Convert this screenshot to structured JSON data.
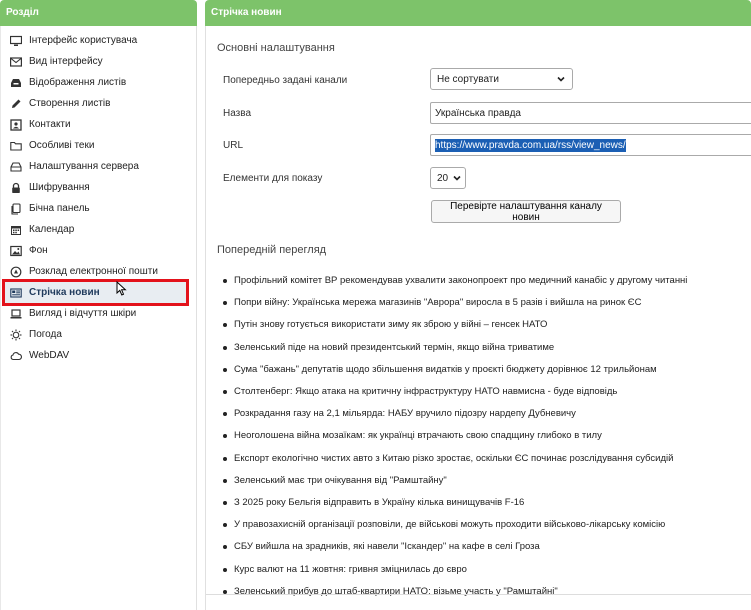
{
  "left": {
    "header": "Розділ",
    "items": [
      {
        "label": "Інтерфейс користувача",
        "icon": "monitor-icon"
      },
      {
        "label": "Вид інтерфейсу",
        "icon": "envelope-icon"
      },
      {
        "label": "Відображення листів",
        "icon": "inbox-icon"
      },
      {
        "label": "Створення листів",
        "icon": "pencil-icon"
      },
      {
        "label": "Контакти",
        "icon": "contact-card-icon"
      },
      {
        "label": "Особливі теки",
        "icon": "folder-icon"
      },
      {
        "label": "Налаштування сервера",
        "icon": "server-icon"
      },
      {
        "label": "Шифрування",
        "icon": "lock-icon"
      },
      {
        "label": "Бічна панель",
        "icon": "copy-icon"
      },
      {
        "label": "Календар",
        "icon": "calendar-icon"
      },
      {
        "label": "Фон",
        "icon": "image-icon"
      },
      {
        "label": "Розклад електронної пошти",
        "icon": "clock-send-icon"
      },
      {
        "label": "Стрічка новин",
        "icon": "newspaper-icon"
      },
      {
        "label": "Вигляд і відчуття шкіри",
        "icon": "laptop-icon"
      },
      {
        "label": "Погода",
        "icon": "sun-icon"
      },
      {
        "label": "WebDAV",
        "icon": "cloud-icon"
      }
    ]
  },
  "right": {
    "header": "Стрічка новин",
    "basic_title": "Основні налаштування",
    "preset_label": "Попередньо задані канали",
    "preset_value": "Не сортувати",
    "name_label": "Назва",
    "name_value": "Українська правда",
    "url_label": "URL",
    "url_value": "https://www.pravda.com.ua/rss/view_news/",
    "items_label": "Елементи для показу",
    "items_value": "20",
    "check_button": "Перевірте налаштування каналу новин",
    "preview_title": "Попередній перегляд",
    "news": [
      "Профільний комітет ВР рекомендував ухвалити законопроект про медичний канабіс у другому читанні",
      "Попри війну: Українська мережа магазинів \"Аврора\" виросла в 5 разів і вийшла на ринок ЄС",
      "Путін знову готується використати зиму як зброю у війні – генсек НАТО",
      "Зеленський піде на новий президентський термін, якщо війна триватиме",
      "Сума \"бажань\" депутатів щодо збільшення видатків у проєкті бюджету дорівнює 12 трильйонам",
      "Столтенберг: Якщо атака на критичну інфраструктуру НАТО навмисна - буде відповідь",
      "Розкрадання газу на 2,1 мільярда: НАБУ вручило підозру нардепу Дубневичу",
      "Неоголошена війна мозаїкам: як українці втрачають свою спадщину глибоко в тилу",
      "Експорт екологічно чистих авто з Китаю різко зростає, оскільки ЄС починає розслідування субсидій",
      "Зеленський має три очікування від \"Рамштайну\"",
      "З 2025 року Бельгія відправить в Україну кілька винищувачів F-16",
      "У правозахисній організації розповіли, де військові можуть проходити військово-лікарську комісію",
      "СБУ вийшла на зрадників, які навели \"Іскандер\" на кафе в селі Гроза",
      "Курс валют на 11 жовтня: гривня зміцнилась до євро",
      "Зеленський прибув до штаб-квартири НАТО: візьме участь у \"Рамштайні\""
    ]
  },
  "colors": {
    "header_green": "#7dc36a",
    "highlight_red": "#e3121b",
    "selection_blue": "#1b5fb4"
  }
}
